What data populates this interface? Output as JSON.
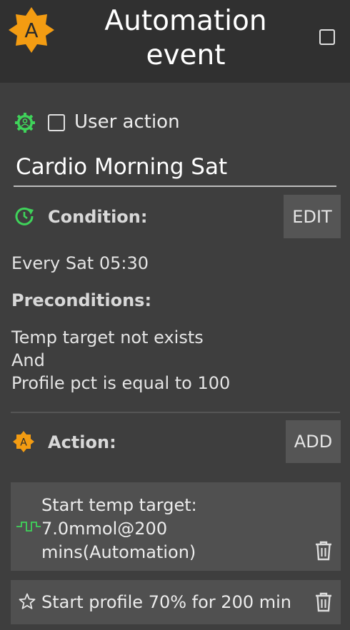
{
  "header": {
    "logo_letter": "A",
    "title_line1": "Automation",
    "title_line2": "event"
  },
  "user_action": {
    "label": "User action",
    "checked": false
  },
  "event_name": "Cardio Morning Sat",
  "condition": {
    "label": "Condition:",
    "edit_label": "EDIT",
    "value": "Every Sat 05:30"
  },
  "preconditions": {
    "label": "Preconditions:",
    "lines": [
      "Temp target not exists",
      "And",
      "Profile pct is equal to 100"
    ]
  },
  "action": {
    "label": "Action:",
    "add_label": "ADD",
    "logo_letter": "A",
    "items": [
      {
        "icon": "temp-target-icon",
        "lines": [
          "Start temp target:",
          "7.0mmol@200",
          "mins(Automation)"
        ]
      },
      {
        "icon": "star-outline-icon",
        "lines": [
          "Start profile 70% for 200 min"
        ]
      }
    ]
  },
  "colors": {
    "accent_orange": "#f39c12",
    "accent_green": "#3fd35a",
    "background": "#3e3e3e",
    "header": "#303030",
    "card": "#505050"
  }
}
